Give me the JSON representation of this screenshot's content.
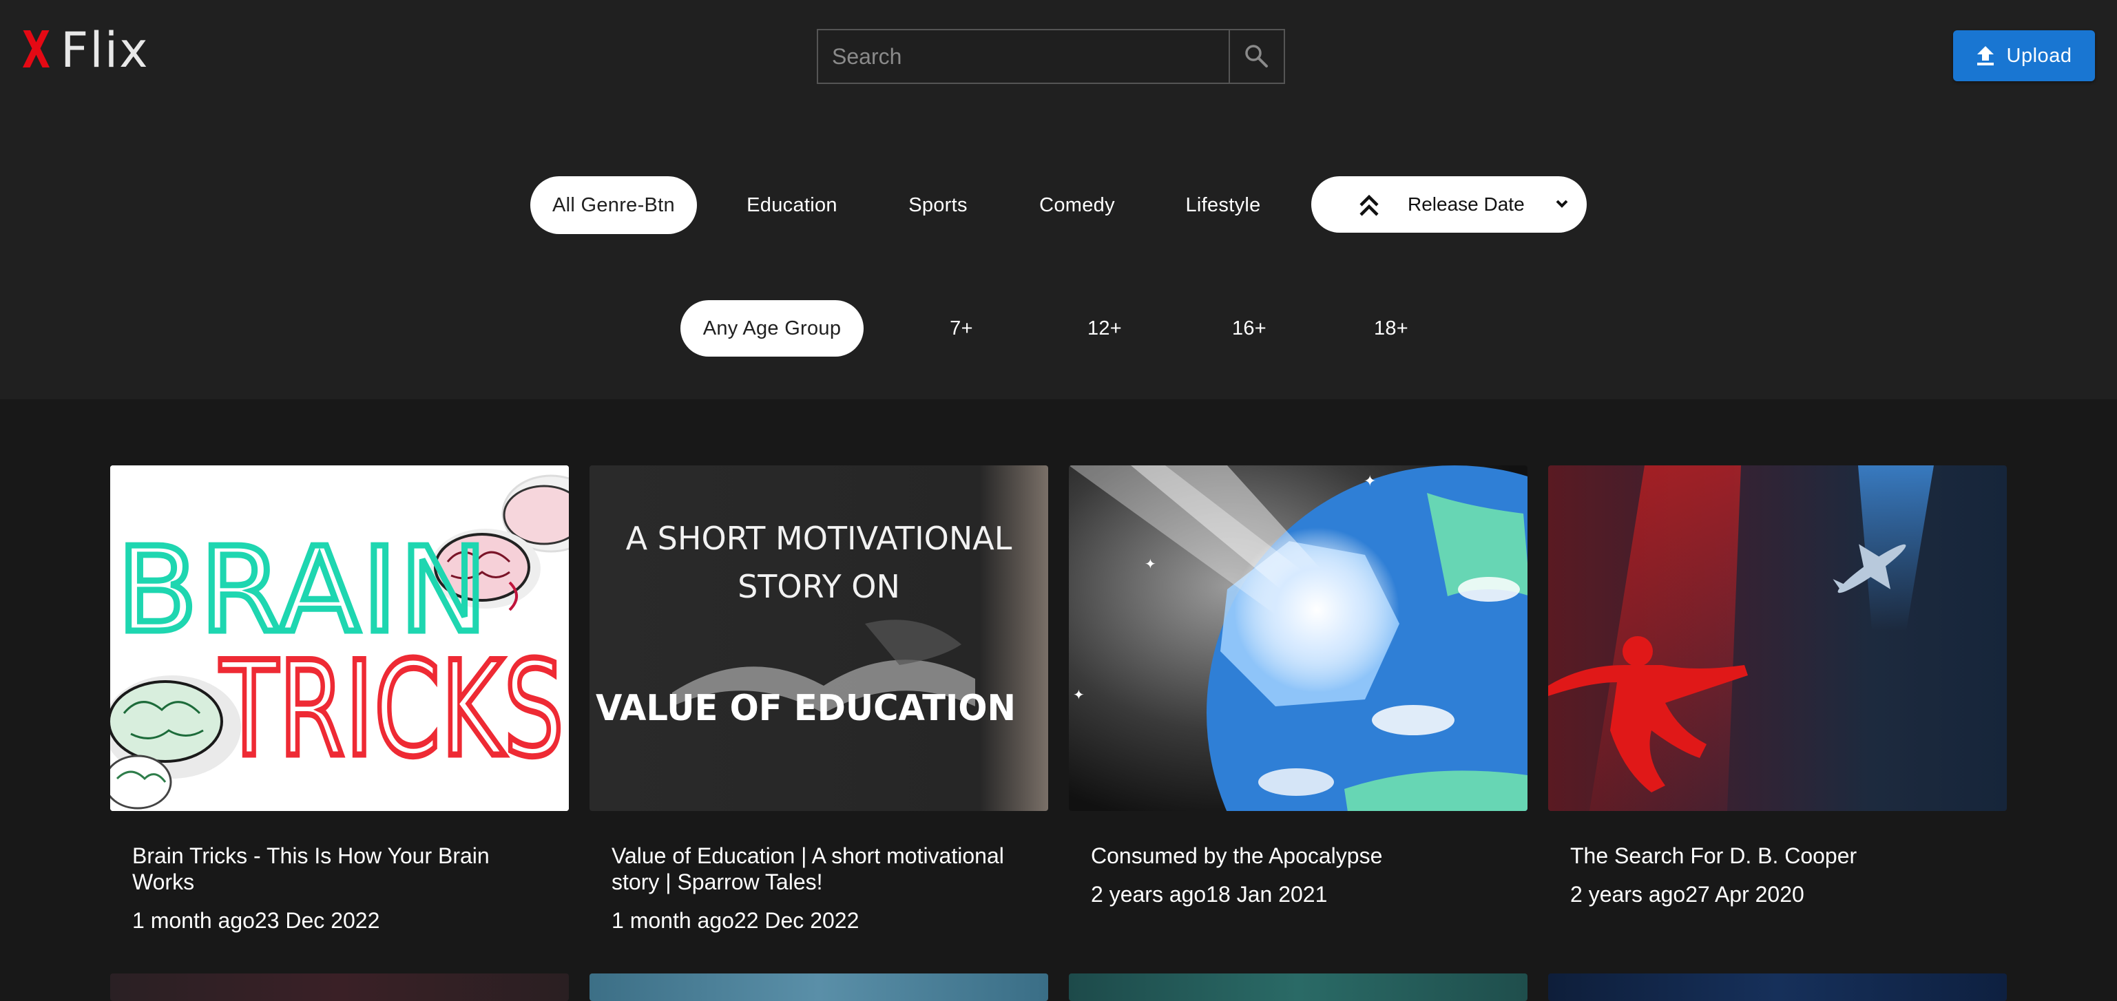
{
  "app": {
    "logo_mark": "X",
    "logo_text": "Flix"
  },
  "search": {
    "placeholder": "Search",
    "value": ""
  },
  "upload": {
    "label": "Upload"
  },
  "genres": [
    {
      "label": "All Genre-Btn",
      "active": true
    },
    {
      "label": "Education",
      "active": false
    },
    {
      "label": "Sports",
      "active": false
    },
    {
      "label": "Comedy",
      "active": false
    },
    {
      "label": "Lifestyle",
      "active": false
    }
  ],
  "sort": {
    "label": "Release Date"
  },
  "age_groups": [
    {
      "label": "Any Age Group",
      "active": true
    },
    {
      "label": "7+",
      "active": false
    },
    {
      "label": "12+",
      "active": false
    },
    {
      "label": "16+",
      "active": false
    },
    {
      "label": "18+",
      "active": false
    }
  ],
  "videos": [
    {
      "title": "Brain Tricks - This Is How Your Brain Works",
      "meta": "1 month ago23 Dec 2022",
      "thumb_text": [
        "BRAIN",
        "TRICKS"
      ]
    },
    {
      "title": "Value of Education | A short motivational story | Sparrow Tales!",
      "meta": "1 month ago22 Dec 2022",
      "thumb_text": [
        "A SHORT MOTIVATIONAL",
        "STORY ON",
        "VALUE OF EDUCATION"
      ]
    },
    {
      "title": "Consumed by the Apocalypse",
      "meta": "2 years ago18 Jan 2021",
      "thumb_text": []
    },
    {
      "title": "The Search For D. B. Cooper",
      "meta": "2 years ago27 Apr 2020",
      "thumb_text": []
    }
  ],
  "colors": {
    "brand_red": "#e50914",
    "upload_blue": "#1976d2",
    "header_bg": "#202020",
    "body_bg": "#181818"
  }
}
